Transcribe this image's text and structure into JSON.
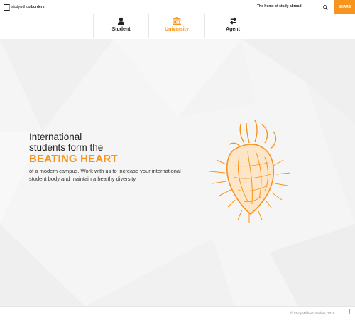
{
  "header": {
    "logo_prefix": "study",
    "logo_mid": "without",
    "logo_suffix": "borders",
    "tagline": "The home of study abroad",
    "share_label": "SHARE"
  },
  "tabs": [
    {
      "label": "Student",
      "icon": "user-icon"
    },
    {
      "label": "University",
      "icon": "building-icon",
      "active": true
    },
    {
      "label": "Agent",
      "icon": "exchange-arrows-icon"
    }
  ],
  "hero": {
    "line1": "International",
    "line2": "students form the",
    "accent": "BEATING HEART",
    "body": "of a modern campus. Work with us to increase your international student body and maintain a healthy diversity."
  },
  "footer": {
    "copyright": "© Study Without Borders, 2016",
    "facebook": "f"
  },
  "colors": {
    "accent": "#f7941d",
    "text": "#222222",
    "background": "#f5f5f5"
  }
}
